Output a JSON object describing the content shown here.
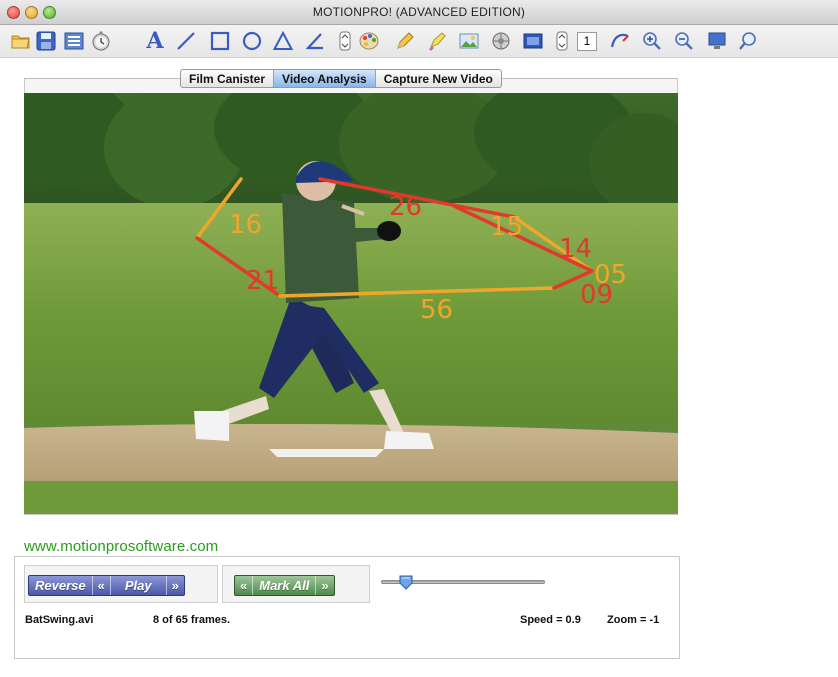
{
  "window": {
    "title": "MOTIONPRO! (ADVANCED EDITION)"
  },
  "toolbar": {
    "icons": [
      "open-folder-icon",
      "save-icon",
      "list-icon",
      "stopwatch-icon",
      "text-tool-icon",
      "line-tool-icon",
      "rectangle-tool-icon",
      "circle-tool-icon",
      "triangle-tool-icon",
      "angle-tool-icon",
      "stepper-icon",
      "color-palette-icon",
      "pencil-icon",
      "highlighter-icon",
      "image-icon",
      "filter-icon",
      "film-icon",
      "stepper-icon",
      "frame-number",
      "curve-icon",
      "zoom-in-icon",
      "zoom-out-icon",
      "screen-icon",
      "magnifier-icon"
    ],
    "text_tool": "A",
    "frame_step": "1"
  },
  "tabs": [
    {
      "label": "Film Canister",
      "active": false
    },
    {
      "label": "Video Analysis",
      "active": true
    },
    {
      "label": "Capture New Video",
      "active": false
    }
  ],
  "video": {
    "angle_labels": [
      {
        "text": "16",
        "color": "#f0a62a"
      },
      {
        "text": "26",
        "color": "#e1392b"
      },
      {
        "text": "15",
        "color": "#f0a62a"
      },
      {
        "text": "14",
        "color": "#e1392b"
      },
      {
        "text": "05",
        "color": "#f0a62a"
      },
      {
        "text": "09",
        "color": "#e1392b"
      },
      {
        "text": "21",
        "color": "#e1392b"
      },
      {
        "text": "56",
        "color": "#f0a62a"
      }
    ]
  },
  "website": "www.motionprosoftware.com",
  "controls": {
    "reverse_label": "Reverse",
    "rewind_label": "«",
    "play_label": "Play",
    "forward_label": "»",
    "mark_prev_label": "«",
    "mark_all_label": "Mark All",
    "mark_next_label": "»",
    "slider_fraction": 0.15
  },
  "status": {
    "filename": "BatSwing.avi",
    "frames": "8 of 65 frames.",
    "speed": "Speed = 0.9",
    "zoom": "Zoom =  -1"
  }
}
